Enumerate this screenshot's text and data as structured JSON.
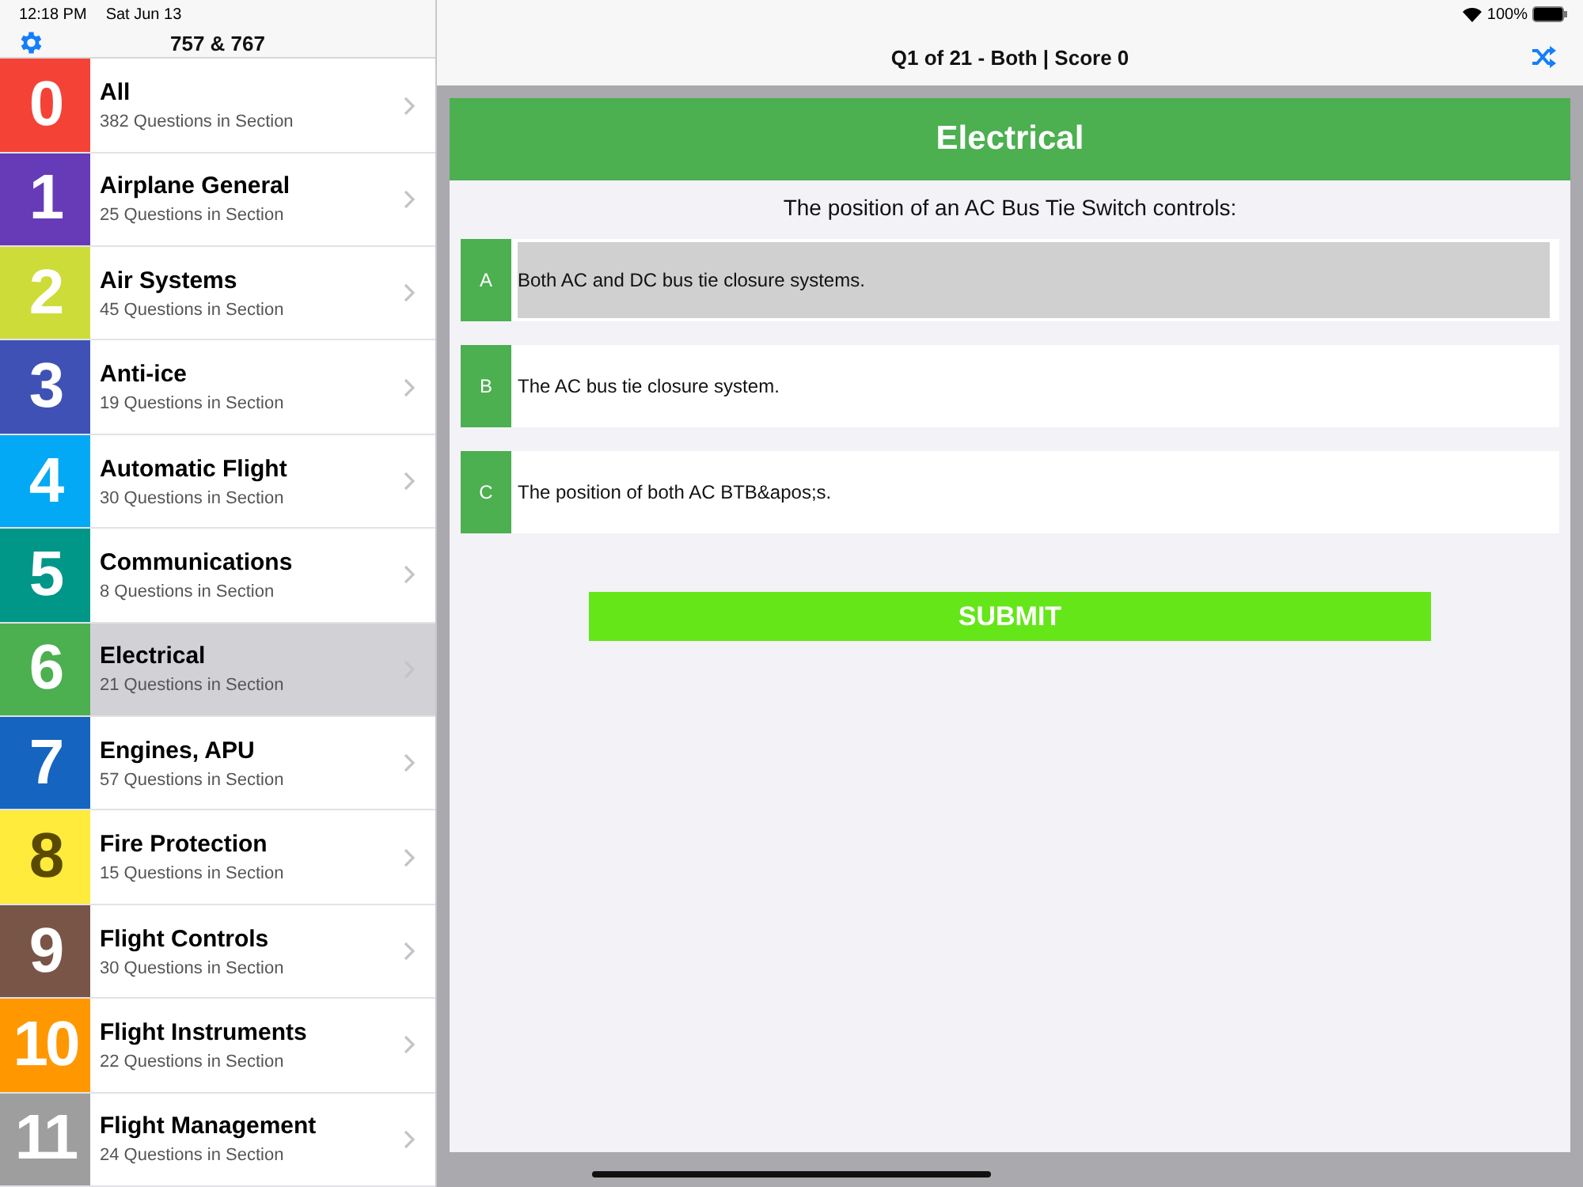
{
  "status_bar": {
    "time": "12:18 PM",
    "date": "Sat Jun 13",
    "battery": "100%"
  },
  "sidebar": {
    "title": "757 & 767",
    "sections": [
      {
        "number": "0",
        "title": "All",
        "subtitle": "382 Questions in Section",
        "color": "#f44336",
        "selected": false
      },
      {
        "number": "1",
        "title": "Airplane General",
        "subtitle": "25 Questions in Section",
        "color": "#673ab7",
        "selected": false
      },
      {
        "number": "2",
        "title": "Air Systems",
        "subtitle": "45 Questions in Section",
        "color": "#cddc39",
        "selected": false
      },
      {
        "number": "3",
        "title": "Anti-ice",
        "subtitle": "19 Questions in Section",
        "color": "#3f51b5",
        "selected": false
      },
      {
        "number": "4",
        "title": "Automatic Flight",
        "subtitle": "30 Questions in Section",
        "color": "#03a9f4",
        "selected": false
      },
      {
        "number": "5",
        "title": "Communications",
        "subtitle": "8 Questions in Section",
        "color": "#009688",
        "selected": false
      },
      {
        "number": "6",
        "title": "Electrical",
        "subtitle": "21 Questions in Section",
        "color": "#4caf50",
        "selected": true
      },
      {
        "number": "7",
        "title": "Engines, APU",
        "subtitle": "57 Questions in Section",
        "color": "#1565c0",
        "selected": false
      },
      {
        "number": "8",
        "title": "Fire Protection",
        "subtitle": "15 Questions in Section",
        "color": "#ffeb3b",
        "selected": false
      },
      {
        "number": "9",
        "title": "Flight Controls",
        "subtitle": "30 Questions in Section",
        "color": "#795548",
        "selected": false
      },
      {
        "number": "10",
        "title": "Flight Instruments",
        "subtitle": "22 Questions in Section",
        "color": "#ff9800",
        "selected": false
      },
      {
        "number": "11",
        "title": "Flight Management",
        "subtitle": "24 Questions in Section",
        "color": "#9e9e9e",
        "selected": false
      }
    ]
  },
  "quiz": {
    "nav_title": "Q1 of 21 - Both | Score 0",
    "section": "Electrical",
    "question": "The position of an AC Bus Tie Switch controls:",
    "answers": [
      {
        "letter": "A",
        "text": "Both AC and DC bus tie closure systems.",
        "selected": true
      },
      {
        "letter": "B",
        "text": "The AC bus tie closure system.",
        "selected": false
      },
      {
        "letter": "C",
        "text": "The position of both AC BTB&apos;s.",
        "selected": false
      }
    ],
    "submit": "SUBMIT"
  }
}
